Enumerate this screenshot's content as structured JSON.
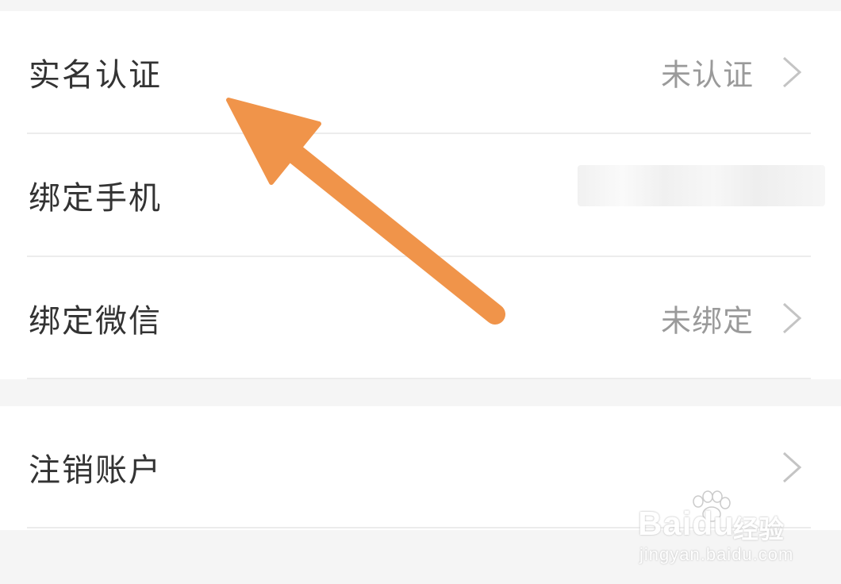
{
  "settings": {
    "rows": [
      {
        "label": "实名认证",
        "value": "未认证"
      },
      {
        "label": "绑定手机",
        "value": ""
      },
      {
        "label": "绑定微信",
        "value": "未绑定"
      },
      {
        "label": "注销账户",
        "value": ""
      }
    ]
  },
  "watermark": {
    "brand": "Baidu",
    "cn": "经验",
    "url": "jingyan.baidu.com"
  },
  "colors": {
    "arrow": "#F0944A",
    "label": "#333333",
    "value": "#9A9A9A",
    "background": "#F5F5F5",
    "card": "#FFFFFF"
  },
  "icons": {
    "chevron": "chevron-right-icon",
    "annotation_arrow": "arrow-up-left-icon"
  }
}
